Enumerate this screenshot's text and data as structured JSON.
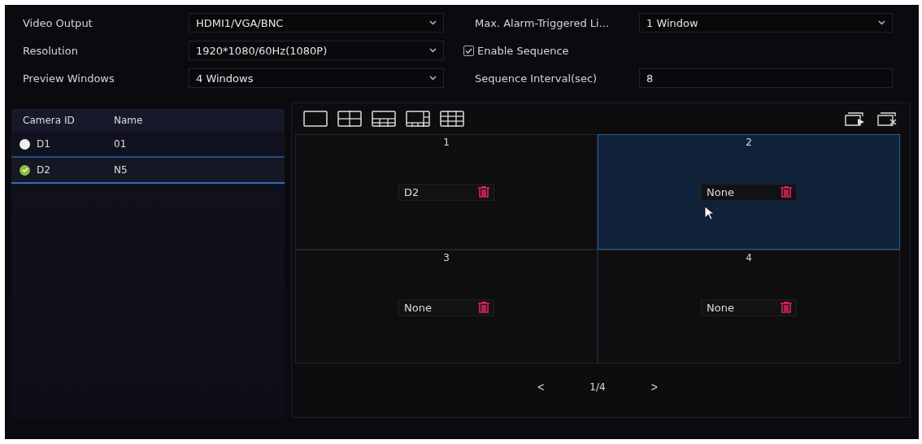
{
  "settings_left": [
    {
      "label": "Video Output",
      "value": "HDMI1/VGA/BNC"
    },
    {
      "label": "Resolution",
      "value": "1920*1080/60Hz(1080P)"
    },
    {
      "label": "Preview Windows",
      "value": "4 Windows"
    }
  ],
  "alarm_windows": {
    "label": "Max. Alarm-Triggered Li...",
    "value": "1 Window"
  },
  "enable_sequence": {
    "label": "Enable Sequence",
    "checked": true
  },
  "sequence_interval": {
    "label": "Sequence Interval(sec)",
    "value": "8"
  },
  "camera_list": {
    "columns": [
      "Camera ID",
      "Name"
    ],
    "rows": [
      {
        "id": "D1",
        "name": "01",
        "added": false,
        "selected": false
      },
      {
        "id": "D2",
        "name": "N5",
        "added": true,
        "selected": true
      }
    ]
  },
  "windows": [
    {
      "number": "1",
      "camera": "D2",
      "selected": false
    },
    {
      "number": "2",
      "camera": "None",
      "selected": true
    },
    {
      "number": "3",
      "camera": "None",
      "selected": false
    },
    {
      "number": "4",
      "camera": "None",
      "selected": false
    }
  ],
  "pager": {
    "prev": "<",
    "page": "1/4",
    "next": ">"
  }
}
